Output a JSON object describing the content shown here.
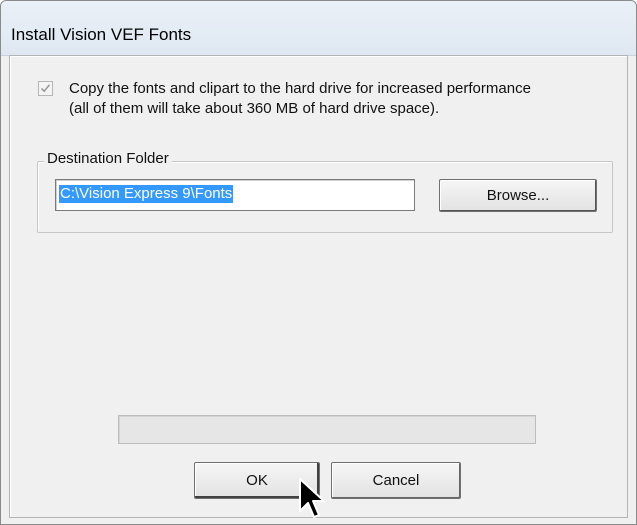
{
  "window": {
    "title": "Install Vision VEF Fonts"
  },
  "options": {
    "copy_checkbox_checked": true,
    "copy_label_line1": "Copy the fonts and clipart to the hard drive for increased performance",
    "copy_label_line2": "(all of them will take about 360 MB of hard drive space)."
  },
  "destination": {
    "group_label": "Destination Folder",
    "path_value": "C:\\Vision Express 9\\Fonts",
    "browse_label": "Browse..."
  },
  "progress": {
    "fraction": 0
  },
  "buttons": {
    "ok_label": "OK",
    "cancel_label": "Cancel"
  },
  "icons": {
    "checkmark": "check-icon",
    "cursor": "mouse-pointer-icon"
  },
  "colors": {
    "selection": "#3399ff",
    "titlebar": "#dfe8f2",
    "dialog_bg": "#f0f0f0"
  }
}
